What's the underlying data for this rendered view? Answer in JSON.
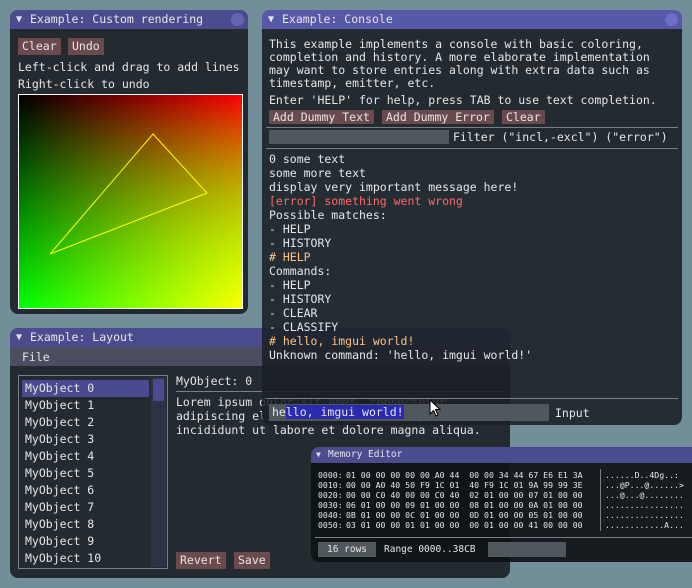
{
  "custom_rendering": {
    "title": "Example: Custom rendering",
    "clear": "Clear",
    "undo": "Undo",
    "help1": "Left-click and drag to add lines",
    "help2": "Right-click to undo"
  },
  "console": {
    "title": "Example: Console",
    "desc": [
      "This example implements a console with basic coloring,",
      "completion and history. A more elaborate implementation",
      "may want to store entries along with extra data such as",
      "timestamp, emitter, etc."
    ],
    "hint": "Enter 'HELP' for help, press TAB to use text completion.",
    "buttons": [
      "Add Dummy Text",
      "Add Dummy Error",
      "Clear"
    ],
    "filter_label": "Filter (\"incl,-excl\") (\"error\")",
    "log": [
      {
        "t": "0 some text",
        "c": "#e6e6e6"
      },
      {
        "t": "some more text",
        "c": "#e6e6e6"
      },
      {
        "t": "display very important message here!",
        "c": "#e6e6e6"
      },
      {
        "t": "[error] something went wrong",
        "c": "#ff6666"
      },
      {
        "t": "Possible matches:",
        "c": "#e6e6e6"
      },
      {
        "t": "- HELP",
        "c": "#e6e6e6"
      },
      {
        "t": "- HISTORY",
        "c": "#e6e6e6"
      },
      {
        "t": "# HELP",
        "c": "#ffc080"
      },
      {
        "t": "Commands:",
        "c": "#e6e6e6"
      },
      {
        "t": "- HELP",
        "c": "#e6e6e6"
      },
      {
        "t": "- HISTORY",
        "c": "#e6e6e6"
      },
      {
        "t": "- CLEAR",
        "c": "#e6e6e6"
      },
      {
        "t": "- CLASSIFY",
        "c": "#e6e6e6"
      },
      {
        "t": "# hello, imgui world!",
        "c": "#ffc080"
      },
      {
        "t": "Unknown command: 'hello, imgui world!'",
        "c": "#e6e6e6"
      }
    ],
    "input_prefix": "he",
    "input_selected": "llo, imgui world!",
    "input_label": "Input"
  },
  "layout": {
    "title": "Example: Layout",
    "menu_file": "File",
    "items": [
      "MyObject 0",
      "MyObject 1",
      "MyObject 2",
      "MyObject 3",
      "MyObject 4",
      "MyObject 5",
      "MyObject 6",
      "MyObject 7",
      "MyObject 8",
      "MyObject 9",
      "MyObject 10"
    ],
    "selected_index": 0,
    "detail_title": "MyObject: 0",
    "lorem": [
      "Lorem ipsum dolor sit amet, consectetur",
      "adipiscing elit, sed do eiusmod tempor",
      "incididunt ut labore et dolore magna aliqua."
    ],
    "revert": "Revert",
    "save": "Save"
  },
  "memory_editor": {
    "title": "Memory Editor",
    "rows": [
      {
        "addr": "0000:",
        "hex": "01 00 00 00 00 00 A0 44  00 00 34 44 67 E6 E1 3A",
        "ascii": "......D..4Dg..:"
      },
      {
        "addr": "0010:",
        "hex": "00 00 A0 40 50 F9 1C 01  40 F9 1C 01 9A 99 99 3E",
        "ascii": "...@P...@......>"
      },
      {
        "addr": "0020:",
        "hex": "00 00 C0 40 00 00 C0 40  02 01 00 00 07 01 00 00",
        "ascii": "...@...@........"
      },
      {
        "addr": "0030:",
        "hex": "06 01 00 00 09 01 00 00  08 01 00 00 0A 01 00 00",
        "ascii": "................"
      },
      {
        "addr": "0040:",
        "hex": "0B 01 00 00 0C 01 00 00  0D 01 00 00 05 01 00 00",
        "ascii": "................"
      },
      {
        "addr": "0050:",
        "hex": "03 01 00 00 01 01 00 00  00 01 00 00 41 00 00 00",
        "ascii": "............A..."
      }
    ],
    "rows_button": "16 rows",
    "range": "Range 0000..38CB"
  },
  "colors": {
    "title_active": "#5858a8",
    "title_inactive": "#4b4b8f",
    "button": "#6b4a4e",
    "window_bg": "#232b31",
    "selection": "#4a4a90"
  }
}
